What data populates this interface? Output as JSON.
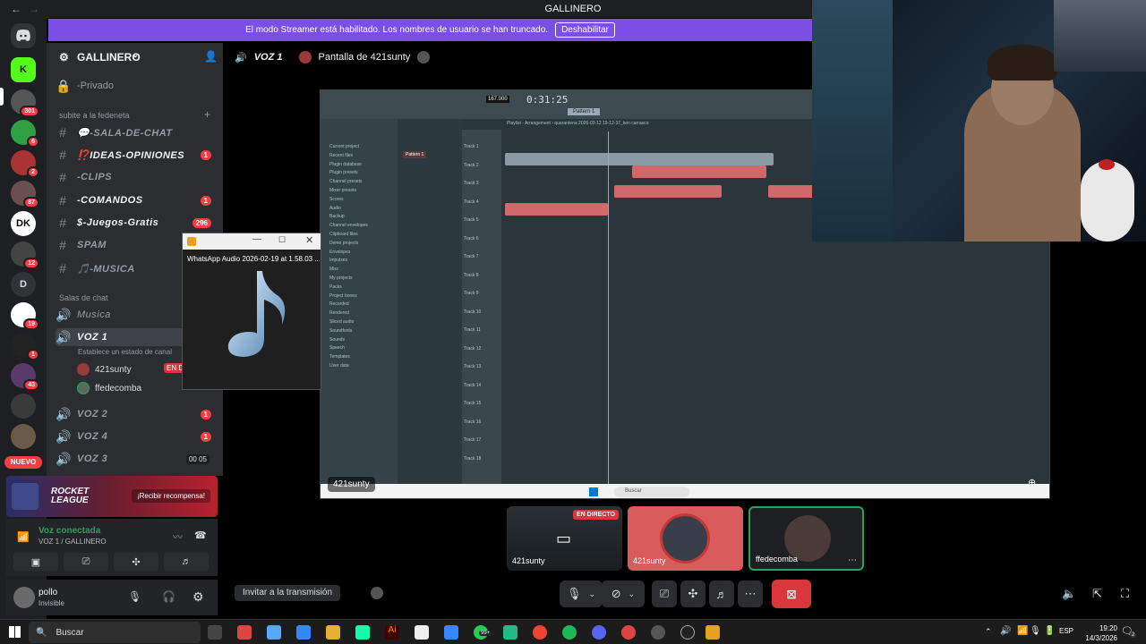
{
  "window": {
    "title": "GALLINERO"
  },
  "banner": {
    "text": "El modo Streamer está habilitado. Los nombres de usuario se han truncado.",
    "button": "Deshabilitar"
  },
  "rail": {
    "badges": [
      "301",
      "6",
      "2",
      "87",
      "12",
      "19",
      "1",
      "43"
    ],
    "letter_server": "D",
    "new_label": "NUEVO"
  },
  "server": {
    "name": "GALLINERO",
    "channels": [
      {
        "name": "-Privado",
        "icon": "🔒"
      },
      {
        "category": "subite a la fedeneta"
      },
      {
        "name": "💬-SALA-DE-CHAT",
        "icon": "#"
      },
      {
        "name": "⁉️IDEAS-OPINIONES",
        "icon": "#",
        "badge": "1"
      },
      {
        "name": "-CLIPS",
        "icon": "#"
      },
      {
        "name": "-COMANDOS",
        "icon": "#",
        "badge": "1"
      },
      {
        "name": "$-Juegos-Gratis",
        "icon": "#",
        "badge": "296"
      },
      {
        "name": "SPAM",
        "icon": "#"
      },
      {
        "name": "🎵-MUSICA",
        "icon": "#"
      }
    ],
    "voice_category": "Salas de chat",
    "voice_channels": {
      "musica": "Musica",
      "voz1": "VOZ 1",
      "voz1_status": "Establece un estado de canal",
      "users": [
        "421sunty",
        "ffedecomba"
      ],
      "live_badge": "EN D",
      "voz2": "VOZ 2",
      "voz2_badge": "1",
      "voz4": "VOZ 4",
      "voz4_badge": "1",
      "voz3": "VOZ 3",
      "voz3_count_a": "00",
      "voz3_count_b": "05"
    }
  },
  "promo": {
    "title_line1": "ROCKET",
    "title_line2": "LEAGUE",
    "button": "¡Recibir recompensa!"
  },
  "voice_panel": {
    "status": "Voz conectada",
    "channel": "VOZ 1 / GALLINERO"
  },
  "user": {
    "name": "pollo",
    "status": "Invisible"
  },
  "voice_header": {
    "channel": "VOZ 1",
    "screen": "Pantalla de 421sunty"
  },
  "share": {
    "label": "421sunty",
    "fl_time": "0:31:25",
    "fl_bpm": "167.000",
    "fl_pattern": "Pattern 1",
    "playlist_title": "Playlist - Arrangement › quarantena 2026-03-12 19-12-37_ken carrasco",
    "browser_items": [
      "Current project",
      "Recent files",
      "Plugin database",
      "Plugin presets",
      "Channel presets",
      "Mixer presets",
      "Scores",
      "Audio",
      "Backup",
      "Channel envelopes",
      "Clipboard files",
      "Demo projects",
      "Envelopes",
      "Impulses",
      "Misc",
      "My projects",
      "Packs",
      "Project bones",
      "Recorded",
      "Rendered",
      "Sliced audio",
      "Soundfonts",
      "Sounds",
      "Speech",
      "Templates",
      "User data"
    ],
    "tracks": [
      "Track 1",
      "Track 2",
      "Track 3",
      "Track 4",
      "Track 5",
      "Track 6",
      "Track 7",
      "Track 8",
      "Track 9",
      "Track 10",
      "Track 11",
      "Track 12",
      "Track 13",
      "Track 14",
      "Track 15",
      "Track 16",
      "Track 17",
      "Track 18"
    ],
    "taskbar_search": "Buscar"
  },
  "popup": {
    "title": "WhatsApp Audio 2026-02-19 at 1.58.03 ..."
  },
  "tiles": [
    {
      "name": "421sunty",
      "badge": "EN DIRECTO"
    },
    {
      "name": "421sunty"
    },
    {
      "name": "ffedecomba"
    }
  ],
  "controls": {
    "invite": "Invitar a la transmisión"
  },
  "taskbar": {
    "search": "Buscar",
    "lang": "ESP",
    "time": "19:20",
    "date": "14/3/2026",
    "tray_badge": "2",
    "whatsapp_badge": "99+"
  }
}
